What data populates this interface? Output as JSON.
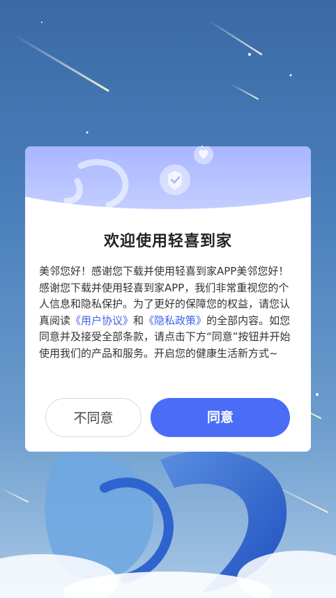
{
  "dialog": {
    "title": "欢迎使用轻喜到家",
    "body_part1": "美邻您好！感谢您下载并使用轻喜到家APP美邻您好！感谢您下载并使用轻喜到家APP，我们非常重视您的个人信息和隐私保护。为了更好的保障您的权益，请您认真阅读",
    "link_user_agreement": "《用户协议》",
    "conjunction": "和",
    "link_privacy_policy": "《隐私政策》",
    "body_part2": "的全部内容。如您同意并及接受全部条款，请点击下方“同意”按钮并开始使用我们的产品和服务。开启您的健康生活新方式~",
    "disagree_label": "不同意",
    "agree_label": "同意"
  },
  "colors": {
    "accent": "#4a6cf7",
    "link": "#3f63e6",
    "header_gradient_top": "#a9b6ff",
    "header_gradient_bottom": "#c3ceff"
  },
  "icons": [
    "shield-check-icon",
    "heart-bubble-icon",
    "bird-logo-icon"
  ]
}
